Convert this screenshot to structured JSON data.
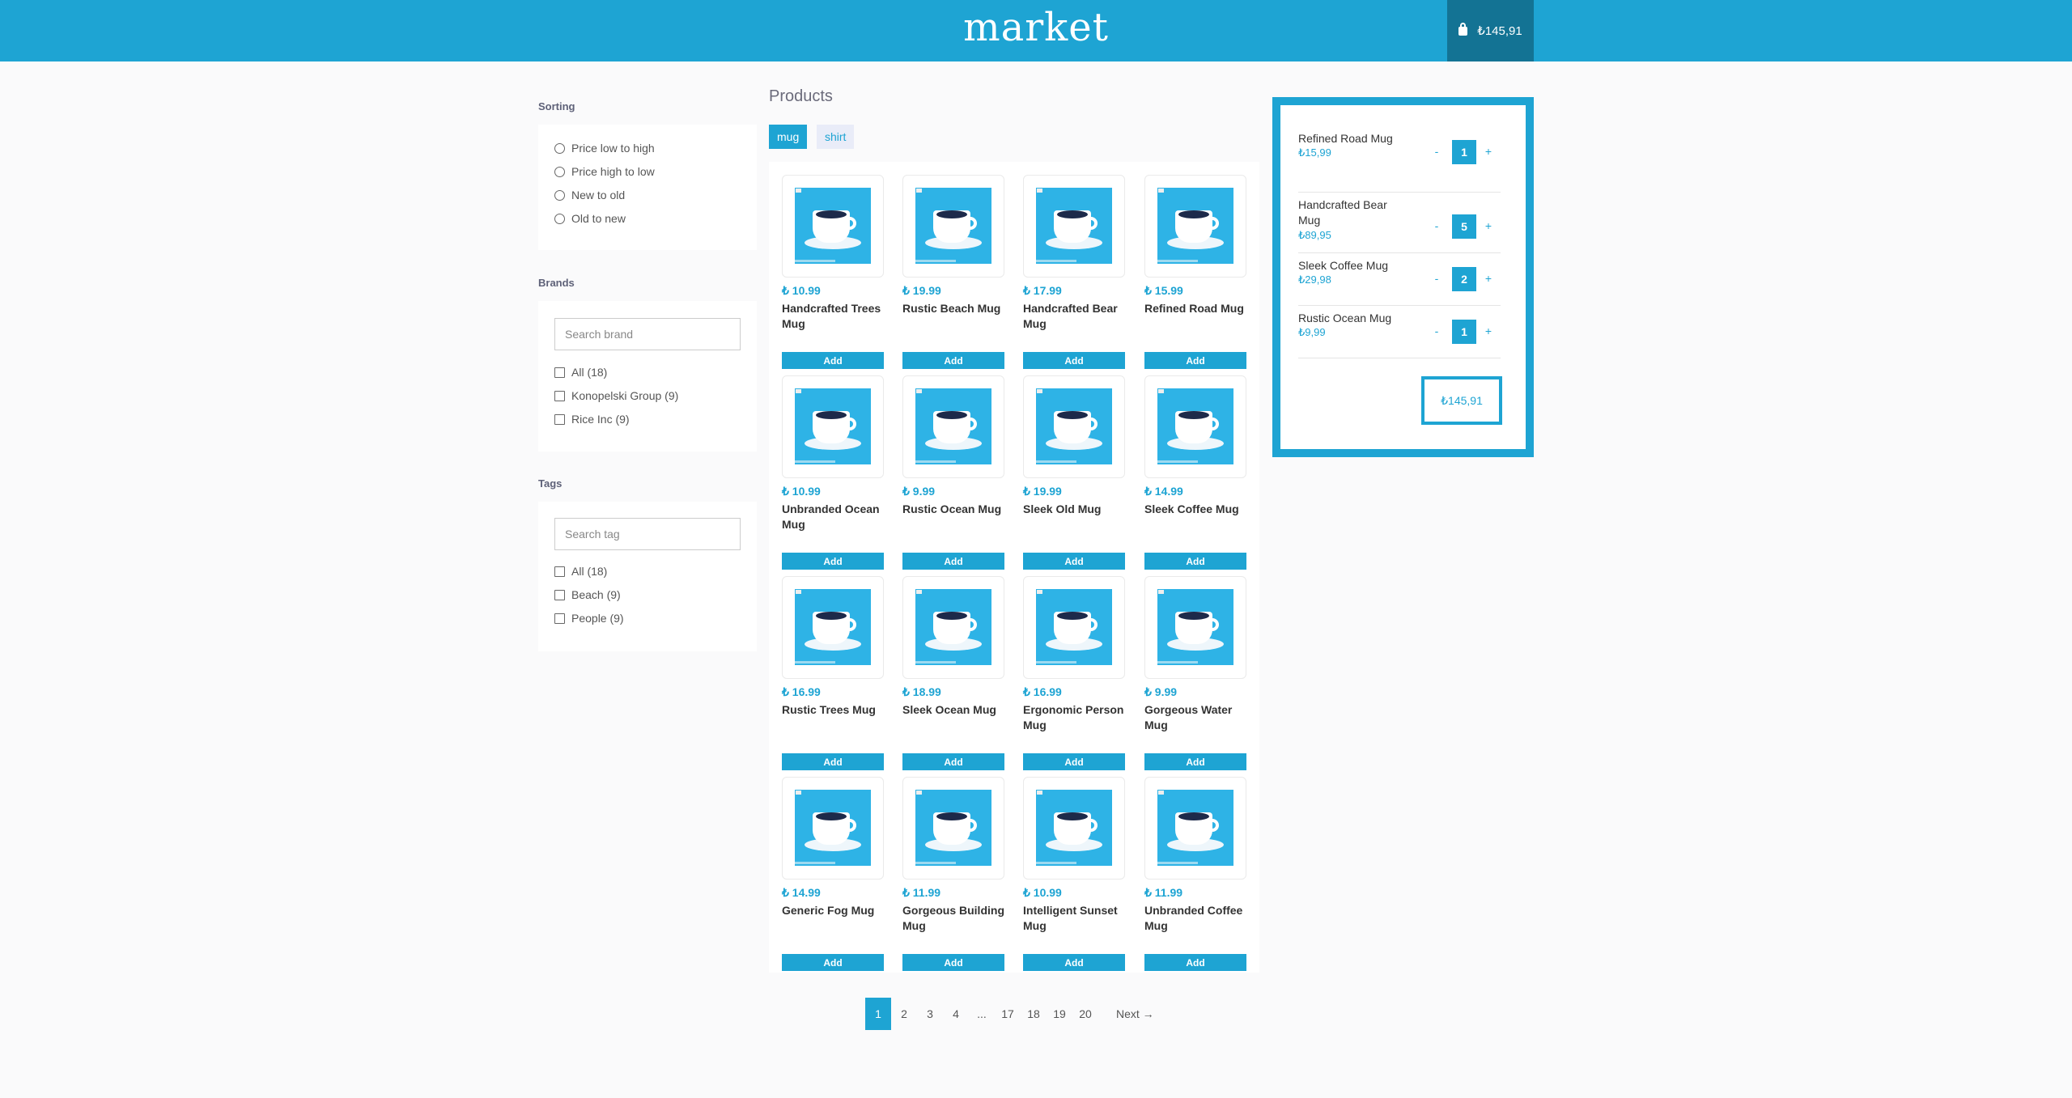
{
  "header": {
    "logo": "market",
    "cart_total": "₺145,91"
  },
  "sorting": {
    "title": "Sorting",
    "options": [
      "Price low to high",
      "Price high to low",
      "New to old",
      "Old to new"
    ]
  },
  "brands": {
    "title": "Brands",
    "placeholder": "Search brand",
    "items": [
      "All (18)",
      "Konopelski Group (9)",
      "Rice Inc (9)"
    ]
  },
  "tags": {
    "title": "Tags",
    "placeholder": "Search tag",
    "items": [
      "All (18)",
      "Beach (9)",
      "People (9)"
    ]
  },
  "products": {
    "title": "Products",
    "type_tabs": [
      "mug",
      "shirt"
    ],
    "add_label": "Add",
    "items": [
      {
        "price": "₺ 10.99",
        "name": "Handcrafted Trees Mug"
      },
      {
        "price": "₺ 19.99",
        "name": "Rustic Beach Mug"
      },
      {
        "price": "₺ 17.99",
        "name": "Handcrafted Bear Mug"
      },
      {
        "price": "₺ 15.99",
        "name": "Refined Road Mug"
      },
      {
        "price": "₺ 10.99",
        "name": "Unbranded Ocean Mug"
      },
      {
        "price": "₺ 9.99",
        "name": "Rustic Ocean Mug"
      },
      {
        "price": "₺ 19.99",
        "name": "Sleek Old Mug"
      },
      {
        "price": "₺ 14.99",
        "name": "Sleek Coffee Mug"
      },
      {
        "price": "₺ 16.99",
        "name": "Rustic Trees Mug"
      },
      {
        "price": "₺ 18.99",
        "name": "Sleek Ocean Mug"
      },
      {
        "price": "₺ 16.99",
        "name": "Ergonomic Person Mug"
      },
      {
        "price": "₺ 9.99",
        "name": "Gorgeous Water Mug"
      },
      {
        "price": "₺ 14.99",
        "name": "Generic Fog Mug"
      },
      {
        "price": "₺ 11.99",
        "name": "Gorgeous Building Mug"
      },
      {
        "price": "₺ 10.99",
        "name": "Intelligent Sunset Mug"
      },
      {
        "price": "₺ 11.99",
        "name": "Unbranded Coffee Mug"
      }
    ]
  },
  "pagination": {
    "pages": [
      "1",
      "2",
      "3",
      "4",
      "...",
      "17",
      "18",
      "19",
      "20"
    ],
    "current": "1",
    "next_label": "Next →"
  },
  "basket": {
    "items": [
      {
        "name": "Refined Road Mug",
        "price": "₺15,99",
        "qty": "1"
      },
      {
        "name": "Handcrafted Bear Mug",
        "price": "₺89,95",
        "qty": "5"
      },
      {
        "name": "Sleek Coffee Mug",
        "price": "₺29,98",
        "qty": "2"
      },
      {
        "name": "Rustic Ocean Mug",
        "price": "₺9,99",
        "qty": "1"
      }
    ],
    "minus_label": "-",
    "plus_label": "+",
    "total": "₺145,91"
  },
  "colors": {
    "accent": "#1ea4d3",
    "cart_dark": "#137394",
    "background": "#fafafb"
  }
}
